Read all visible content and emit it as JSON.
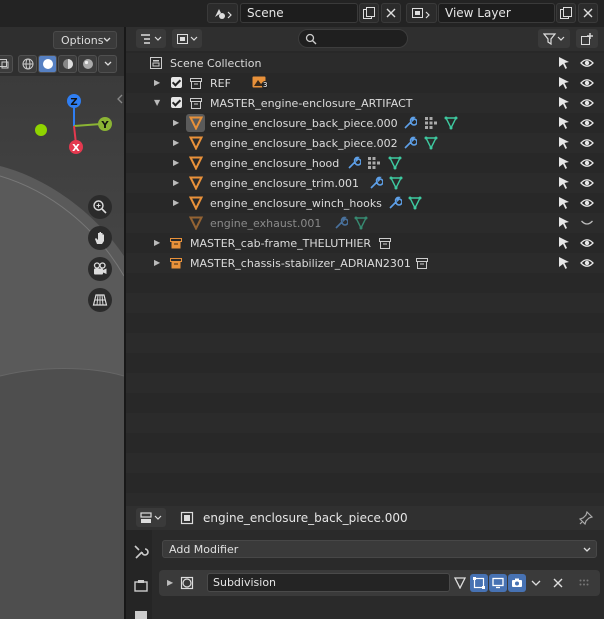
{
  "topbar": {
    "scene_label": "Scene",
    "view_layer_label": "View Layer"
  },
  "viewport": {
    "options_label": "Options",
    "gizmo_axes": {
      "z": "Z",
      "y": "Y",
      "x": "X"
    },
    "colors": {
      "x_axis": "#e4394f",
      "y_axis": "#8bb434",
      "z_axis": "#2f7ef2",
      "origin_dot": "#8fd400"
    }
  },
  "outliner": {
    "search_placeholder": "",
    "rows": [
      {
        "label": "Scene Collection",
        "type": "scene-collection"
      },
      {
        "label": "REF",
        "type": "collection",
        "badge": "3"
      },
      {
        "label": "MASTER_engine-enclosure_ARTIFACT",
        "type": "collection"
      },
      {
        "label": "engine_enclosure_back_piece.000",
        "type": "mesh",
        "active": true
      },
      {
        "label": "engine_enclosure_back_piece.002",
        "type": "mesh"
      },
      {
        "label": "engine_enclosure_hood",
        "type": "mesh"
      },
      {
        "label": "engine_enclosure_trim.001",
        "type": "mesh"
      },
      {
        "label": "engine_enclosure_winch_hooks",
        "type": "mesh"
      },
      {
        "label": "engine_exhaust.001",
        "type": "mesh",
        "hidden": true
      },
      {
        "label": "MASTER_cab-frame_THELUTHIER",
        "type": "linked-collection"
      },
      {
        "label": "MASTER_chassis-stabilizer_ADRIAN2301",
        "type": "linked-collection"
      }
    ],
    "colors": {
      "mesh_orange": "#e8913a",
      "data_green": "#3ec9a0",
      "wrench_blue": "#5ea0e8"
    }
  },
  "properties": {
    "object_name": "engine_enclosure_back_piece.000",
    "add_modifier_label": "Add Modifier",
    "modifier_name": "Subdivision",
    "colors": {
      "toggle_blue": "#4772b3"
    }
  }
}
